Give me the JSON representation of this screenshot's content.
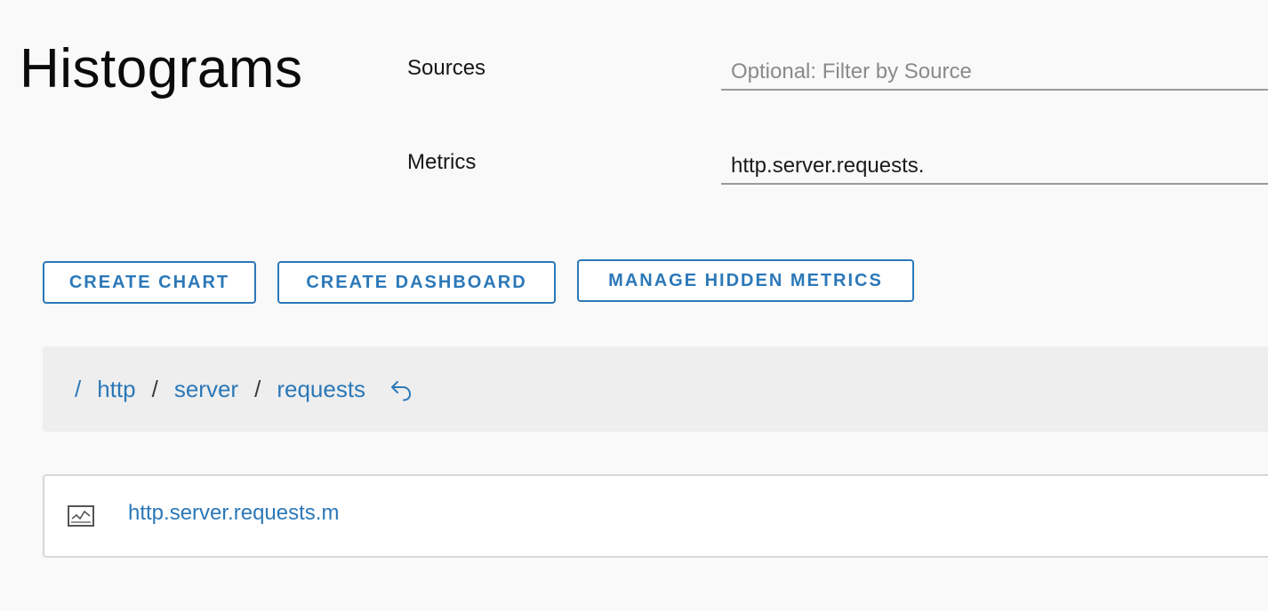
{
  "page": {
    "title": "Histograms"
  },
  "filters": {
    "sources_label": "Sources",
    "sources_placeholder": "Optional: Filter by Source",
    "sources_value": "",
    "metrics_label": "Metrics",
    "metrics_value": "http.server.requests."
  },
  "actions": {
    "create_chart": "CREATE CHART",
    "create_dashboard": "CREATE DASHBOARD",
    "manage_hidden_metrics": "MANAGE HIDDEN METRICS"
  },
  "breadcrumb": {
    "separator": "/",
    "items": [
      "http",
      "server",
      "requests"
    ],
    "back_icon": "undo-arrow-icon"
  },
  "results": [
    {
      "icon": "line-chart-icon",
      "name": "http.server.requests.m"
    }
  ],
  "colors": {
    "accent": "#2c78b8",
    "background": "#f9f9f9",
    "breadcrumb_bg": "#eeeeee"
  }
}
